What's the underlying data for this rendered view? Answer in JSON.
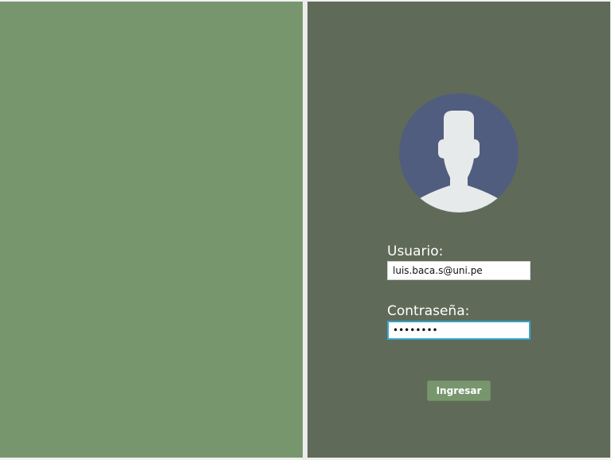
{
  "colors": {
    "left_panel": "#78966e",
    "right_panel": "#5f6b58",
    "divider": "#ececec",
    "avatar_background": "#515d7e",
    "avatar_silhouette": "#e7eaeb",
    "button": "#78966e",
    "focus_border": "#3aa3c9"
  },
  "login": {
    "avatar_icon": "user-silhouette-icon",
    "username": {
      "label": "Usuario:",
      "value": "luis.baca.s@uni.pe"
    },
    "password": {
      "label": "Contraseña:",
      "value": "••••••••"
    },
    "submit_label": "Ingresar"
  }
}
